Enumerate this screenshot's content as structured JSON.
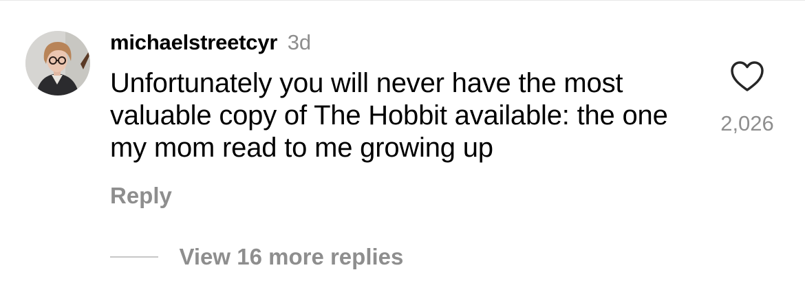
{
  "comment": {
    "username": "michaelstreetcyr",
    "timestamp": "3d",
    "text": "Unfortunately you will never have the most valuable copy of The Hobbit available: the one my mom read to me growing up",
    "like_count": "2,026",
    "reply_label": "Reply",
    "view_replies_label": "View 16 more replies"
  },
  "icons": {
    "like": "heart-outline-icon",
    "avatar": "user-avatar"
  },
  "colors": {
    "text_primary": "#000000",
    "text_secondary": "#8e8e8e",
    "divider": "#c7c7c7"
  }
}
